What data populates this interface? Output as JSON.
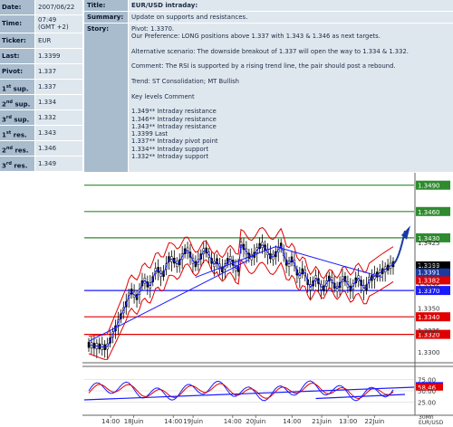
{
  "left_panel": {
    "date_label": "Date:",
    "date_value": "2007/06/22",
    "time_label": "Time:",
    "time_value_1": "07:49",
    "time_value_2": "(GMT +2)",
    "ticker_label": "Ticker:",
    "ticker_value": "EUR",
    "last_label": "Last:",
    "last_value": "1.3399",
    "pivot_label": "Pivot:",
    "pivot_value": "1.337",
    "sup1_label_num": "1",
    "sup1_label_suffix": "st",
    "sup1_label_word": " sup.",
    "sup1_value": "1.337",
    "sup2_label_num": "2",
    "sup2_label_suffix": "nd",
    "sup2_label_word": " sup.",
    "sup2_value": "1.334",
    "sup3_label_num": "3",
    "sup3_label_suffix": "rd",
    "sup3_label_word": " sup.",
    "sup3_value": "1.332",
    "res1_label_num": "1",
    "res1_label_suffix": "st",
    "res1_label_word": " res.",
    "res1_value": "1.343",
    "res2_label_num": "2",
    "res2_label_suffix": "nd",
    "res2_label_word": " res.",
    "res2_value": "1.346",
    "res3_label_num": "3",
    "res3_label_suffix": "rd",
    "res3_label_word": " res.",
    "res3_value": "1.349"
  },
  "right_panel": {
    "title_label": "Title:",
    "title_value": "EUR/USD intraday:",
    "summary_label": "Summary:",
    "summary_value": "Update on supports and resistances.",
    "story_label": "Story:",
    "story_lines": [
      "Pivot: 1.3370.",
      "Our Preference: LONG positions above 1.337 with 1.343 & 1.346 as next targets.",
      "",
      "Alternative scenario: The downside breakout of 1.337 will open the way to 1.334 & 1.332.",
      "",
      "Comment: The RSI is supported by a rising trend line, the pair should post a rebound.",
      "",
      "Trend: ST Consolidation; MT Bullish",
      "",
      "Key levels Comment",
      "",
      "1.349** Intraday resistance",
      "1.346** Intraday resistance",
      "1.343** Intraday resistance",
      "1.3399 Last",
      "1.337** Intraday pivot point",
      "1.334** Intraday support",
      "1.332** Intraday support"
    ]
  },
  "chart": {
    "level_labels": [
      "1.3490",
      "1.3460",
      "1.3430",
      "1.3399",
      "1.3391",
      "1.3382",
      "1.3370",
      "1.3340",
      "1.3320"
    ],
    "axis_labels": [
      "1.3425",
      "1.3400",
      "1.3375",
      "1.3350",
      "1.3325",
      "1.3300"
    ],
    "rsi_labels": [
      "75.00",
      "61.27",
      "58.46",
      "50.00",
      "25.00"
    ],
    "time_labels": [
      "14:00",
      "18Juin",
      "14:00",
      "19Juin",
      "14:00",
      "20Juin",
      "14:00",
      "21Juin",
      "13:00",
      "22Juin"
    ],
    "timeframe": "30Mn",
    "instrument": "EUR/USD",
    "colors": {
      "resistance": "#2e8b2e",
      "support": "#e00000",
      "pivot": "#1a1aff",
      "price": "#000000",
      "bollinger": "#e00000",
      "ma": "#1a1aff",
      "last": "#1a3aa0"
    }
  }
}
